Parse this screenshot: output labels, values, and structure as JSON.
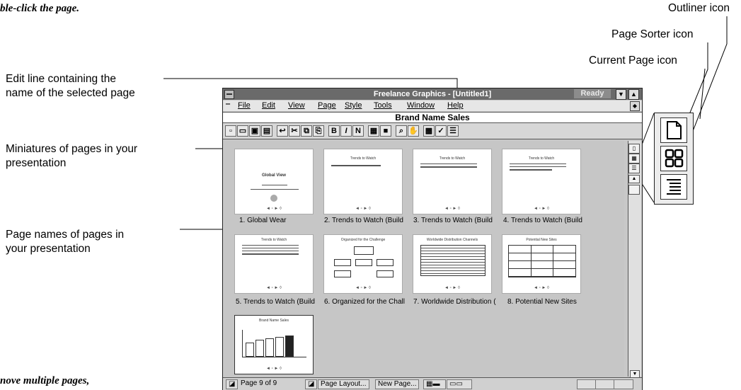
{
  "doc": {
    "top_text": "ble-click the page.",
    "bottom_text": "nove multiple pages,"
  },
  "callouts": {
    "outliner": "Outliner icon",
    "page_sorter": "Page Sorter icon",
    "current_page": "Current Page icon",
    "edit_line": "Edit line containing the\nname of the selected page",
    "miniatures": "Miniatures of pages in your\npresentation",
    "page_names": "Page names of pages in\nyour presentation"
  },
  "window": {
    "title": "Freelance Graphics - [Untitled1]",
    "status": "Ready",
    "menus": [
      "File",
      "Edit",
      "View",
      "Page",
      "Style",
      "Tools",
      "Window",
      "Help"
    ],
    "edit_line_value": "Brand Name Sales",
    "toolbar_letters": {
      "bold": "B",
      "italic": "I",
      "normal": "N"
    }
  },
  "pages": [
    {
      "label": "1.  Global Wear",
      "thumb_title": "Global View",
      "pager": "◄ ▫ ► ◊"
    },
    {
      "label": "2.  Trends to Watch (Build",
      "thumb_title": "Trends to Watch",
      "pager": "◄ ▫ ► ◊"
    },
    {
      "label": "3.  Trends to Watch (Build",
      "thumb_title": "Trends to Watch",
      "pager": "◄ ▫ ► ◊"
    },
    {
      "label": "4.  Trends to Watch (Build",
      "thumb_title": "Trends to Watch",
      "pager": "◄ ▫ ► ◊"
    },
    {
      "label": "5.  Trends to Watch (Build",
      "thumb_title": "Trends to Watch",
      "pager": "◄ ▫ ► ◊"
    },
    {
      "label": "6.  Organized for the Chall",
      "thumb_title": "Organized for the Challenge",
      "pager": "◄ ▫ ► ◊"
    },
    {
      "label": "7.  Worldwide Distribution (",
      "thumb_title": "Worldwide Distribution Channels",
      "pager": "◄ ▫ ► ◊"
    },
    {
      "label": "8.  Potential New Sites",
      "thumb_title": "Potential New Sites",
      "pager": "◄ ▫ ► ◊"
    },
    {
      "label": "",
      "thumb_title": "Brand Name Sales",
      "pager": "◄ ▫ ► ◊"
    }
  ],
  "statusbar": {
    "page_info": "Page 9 of 9",
    "page_layout": "Page Layout...",
    "new_page": "New Page..."
  },
  "icons": [
    "system-menu-icon",
    "current-page-icon",
    "page-sorter-icon",
    "outliner-icon"
  ]
}
